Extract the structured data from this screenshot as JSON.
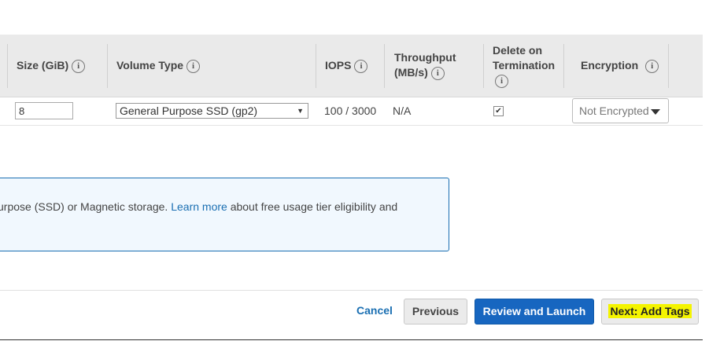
{
  "table": {
    "headers": {
      "size": "Size (GiB)",
      "volume_type": "Volume Type",
      "iops": "IOPS",
      "throughput_line1": "Throughput",
      "throughput_line2": "(MB/s)",
      "delete_line1": "Delete on",
      "delete_line2": "Termination",
      "encryption": "Encryption"
    },
    "info_glyph": "i",
    "row": {
      "size_value": "8",
      "volume_type": "General Purpose SSD (gp2)",
      "iops": "100 / 3000",
      "throughput": "N/A",
      "delete_on_termination": true,
      "encryption": "Not Encrypted"
    }
  },
  "notice": {
    "text_before": "urpose (SSD) or Magnetic storage.",
    "link": "Learn more",
    "text_after": "about free usage tier eligibility and"
  },
  "footer": {
    "cancel": "Cancel",
    "previous": "Previous",
    "review_launch": "Review and Launch",
    "next": "Next: Add Tags"
  },
  "colors": {
    "link": "#1a6fb2",
    "primary_button": "#1766c0",
    "highlight": "#f4f400",
    "notice_bg": "#f1f8fe"
  },
  "icons": {
    "info": "info-circle-icon",
    "checkbox": "checkmark-icon",
    "dropdown": "triangle-down-icon"
  }
}
